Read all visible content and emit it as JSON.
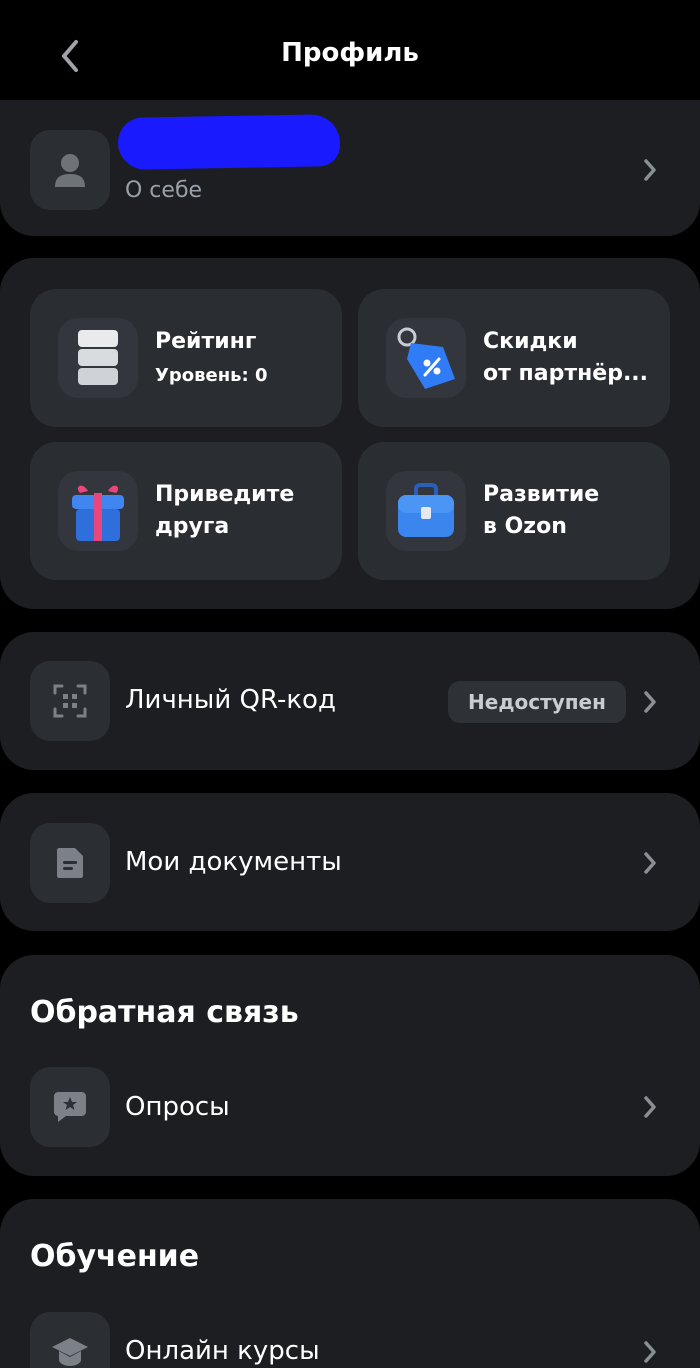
{
  "header": {
    "title": "Профиль"
  },
  "profile": {
    "about_label": "О себе"
  },
  "tiles": [
    {
      "line1": "Рейтинг",
      "line2": "Уровень: 0",
      "icon": "rating-stack-icon"
    },
    {
      "line1": "Скидки",
      "line2": "от партнёр...",
      "icon": "discount-tag-icon"
    },
    {
      "line1": "Приведите",
      "line2": "друга",
      "icon": "gift-icon"
    },
    {
      "line1": "Развитие",
      "line2": "в Ozon",
      "icon": "briefcase-icon"
    }
  ],
  "qr": {
    "label": "Личный QR-код",
    "badge": "Недоступен"
  },
  "documents": {
    "label": "Мои документы"
  },
  "feedback": {
    "section_title": "Обратная связь",
    "surveys_label": "Опросы"
  },
  "education": {
    "section_title": "Обучение",
    "courses_label": "Онлайн курсы"
  },
  "colors": {
    "background": "#000000",
    "card": "#1c1e22",
    "tile": "#2a2d32",
    "accent_blue": "#2f7cf6",
    "muted_text": "#9aa0a8"
  }
}
